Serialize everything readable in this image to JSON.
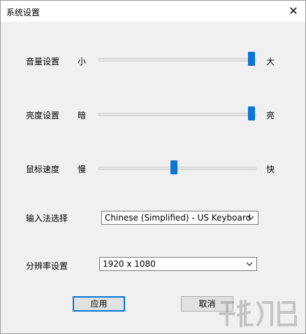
{
  "window": {
    "title": "系统设置",
    "close_glyph": "✕"
  },
  "settings": {
    "volume": {
      "label": "音量设置",
      "min_label": "小",
      "max_label": "大",
      "level": 1.0
    },
    "brightness": {
      "label": "亮度设置",
      "min_label": "暗",
      "max_label": "亮",
      "level": 1.0
    },
    "mouse_speed": {
      "label": "鼠标速度",
      "min_label": "慢",
      "max_label": "快",
      "level": 0.48
    },
    "input_method": {
      "label": "输入法选择",
      "selected": "Chinese (Simplified) - US Keyboard"
    },
    "resolution": {
      "label": "分辨率设置",
      "selected": "1920 x 1080"
    }
  },
  "buttons": {
    "apply": "应用",
    "cancel": "取消"
  },
  "colors": {
    "accent": "#0a75d6",
    "background": "#f0f0f0"
  }
}
